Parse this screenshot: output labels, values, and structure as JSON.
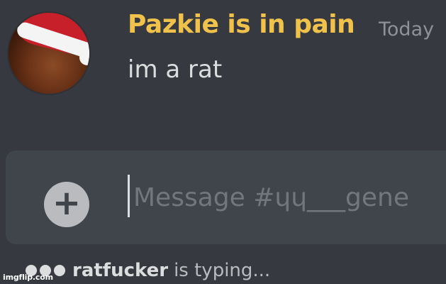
{
  "colors": {
    "background": "#36393f",
    "composer_background": "#40444b",
    "username": "#f0c24b",
    "message_text": "#dcddde",
    "placeholder": "#72767d",
    "timestamp": "#8e9297"
  },
  "message": {
    "author": "Pazkie is in pain",
    "timestamp": "Today",
    "text": "im a rat",
    "avatar_icon": "santa-hat-avatar"
  },
  "composer": {
    "placeholder": "Message #ɥɥ___gene",
    "attach_icon": "plus-circle-icon",
    "attach_symbol": "+"
  },
  "typing_indicator": {
    "user": "ratfucker",
    "suffix": "is typing..."
  },
  "watermark": "imgflip.com"
}
